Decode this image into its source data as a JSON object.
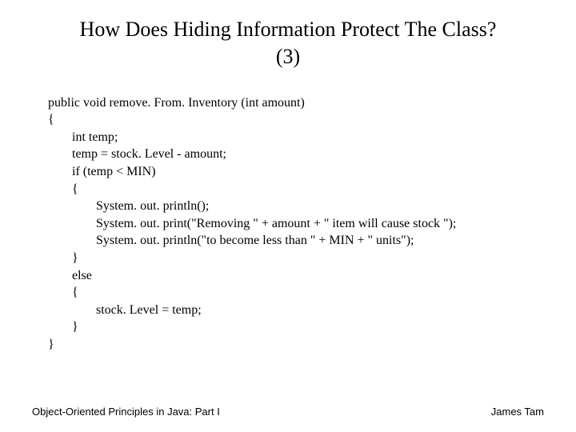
{
  "title_line1": "How Does Hiding Information Protect The Class?",
  "title_line2": "(3)",
  "code": {
    "l0": "public void remove. From. Inventory (int amount)",
    "l1": "{",
    "l2": "int temp;",
    "l3": "temp = stock. Level - amount;",
    "l4": "if (temp < MIN)",
    "l5": "{",
    "l6": "System. out. println();",
    "l7": "System. out. print(\"Removing \" + amount + \" item will cause stock \");",
    "l8": "System. out. println(\"to become less than \" + MIN + \" units\");",
    "l9": "}",
    "l10": "else",
    "l11": "{",
    "l12": "stock. Level = temp;",
    "l13": "}",
    "l14": "}"
  },
  "footer_left": "Object-Oriented Principles in Java: Part I",
  "footer_right": "James Tam"
}
